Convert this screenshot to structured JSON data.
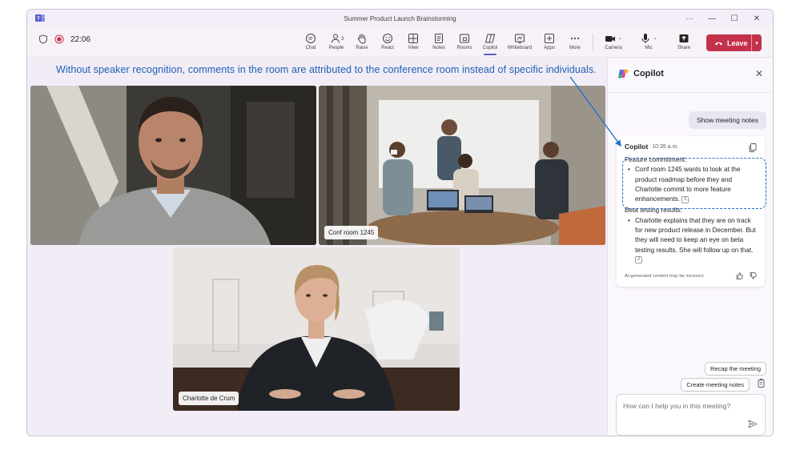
{
  "window": {
    "title": "Summer Product Launch Brainstorming"
  },
  "toolbar": {
    "timer": "22:06",
    "people_count": "3",
    "items": [
      {
        "label": "Chat",
        "icon": "chat-icon"
      },
      {
        "label": "People",
        "icon": "people-icon"
      },
      {
        "label": "Raise",
        "icon": "raise-hand-icon"
      },
      {
        "label": "React",
        "icon": "react-icon"
      },
      {
        "label": "View",
        "icon": "view-icon"
      },
      {
        "label": "Notes",
        "icon": "notes-icon"
      },
      {
        "label": "Rooms",
        "icon": "rooms-icon"
      },
      {
        "label": "Copilot",
        "icon": "copilot-icon"
      },
      {
        "label": "Whiteboard",
        "icon": "whiteboard-icon"
      },
      {
        "label": "Apps",
        "icon": "apps-icon"
      },
      {
        "label": "More",
        "icon": "more-icon"
      }
    ],
    "camera_label": "Camera",
    "mic_label": "Mic",
    "share_label": "Share",
    "leave_label": "Leave"
  },
  "stage": {
    "banner": "Without speaker recognition, comments in the room are attributed to the conference room instead of specific individuals.",
    "tiles": [
      {
        "name": ""
      },
      {
        "name": "Conf room 1245"
      },
      {
        "name": "Charlotte de Crum"
      }
    ]
  },
  "copilot": {
    "title": "Copilot",
    "show_notes": "Show meeting notes",
    "message": {
      "author": "Copilot",
      "time": "10:35 a.m.",
      "section1_title": "Feature commitment:",
      "section1_bullet": "Conf room 1245 wants to look at the product roadmap before they and Charlotte commit to more feature enhancements.",
      "section1_ref": "1",
      "section2_title": "Beta testing results:",
      "section2_bullet": "Charlotte explains that they are on track for new product release in December. But they will need to keep an eye on beta testing results. She will follow up on that.",
      "section2_ref": "2",
      "disclaimer": "AI-generated content may be incorrect"
    },
    "suggestions": [
      "Recap the meeting",
      "Create meeting notes"
    ],
    "input_placeholder": "How can I help you in this meeting?"
  },
  "colors": {
    "accent": "#5b5fc7",
    "leave": "#c4314b",
    "annotation": "#1f6fc7"
  }
}
